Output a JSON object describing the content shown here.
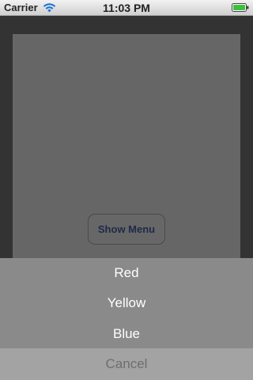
{
  "status_bar": {
    "carrier": "Carrier",
    "time": "11:03 PM",
    "wifi_icon": "wifi-icon",
    "battery_icon": "battery-icon"
  },
  "main": {
    "show_menu_label": "Show Menu"
  },
  "action_sheet": {
    "options": [
      "Red",
      "Yellow",
      "Blue"
    ],
    "cancel_label": "Cancel"
  }
}
